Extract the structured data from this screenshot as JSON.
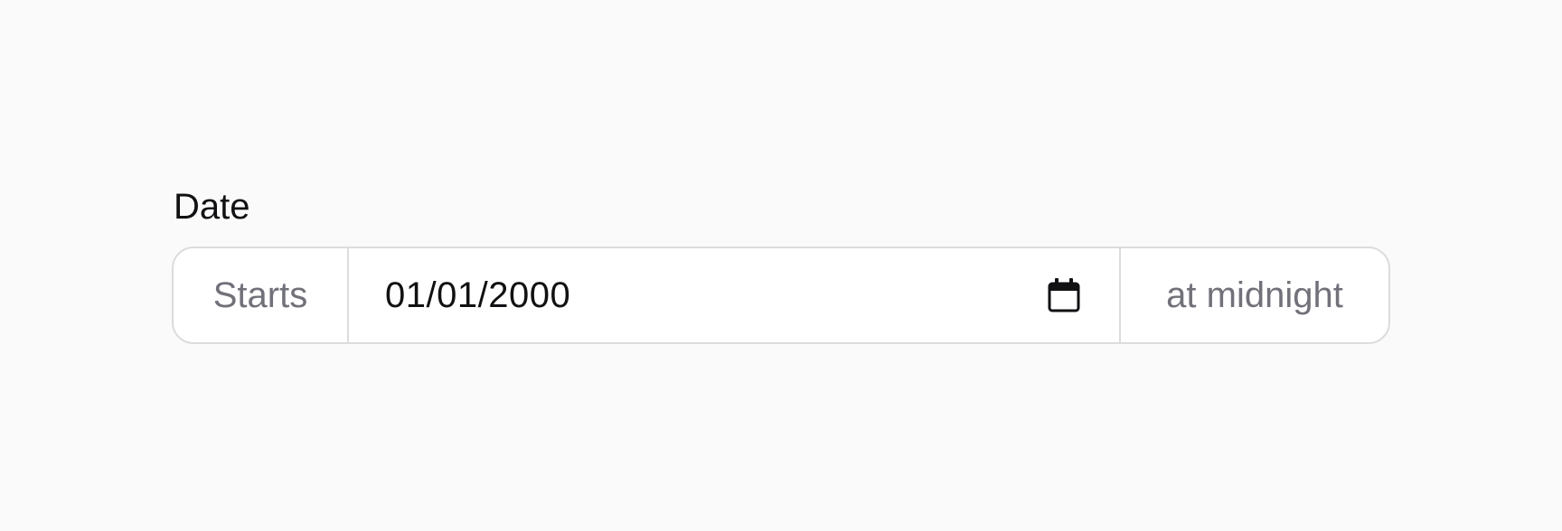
{
  "field": {
    "label": "Date",
    "prefix": "Starts",
    "value": "01/01/2000",
    "suffix": "at midnight",
    "picker_icon": "calendar-icon"
  },
  "colors": {
    "background": "#fafafa",
    "input_background": "#ffffff",
    "border": "#dcdcde",
    "addon_text": "#71717a",
    "text": "#111114"
  }
}
